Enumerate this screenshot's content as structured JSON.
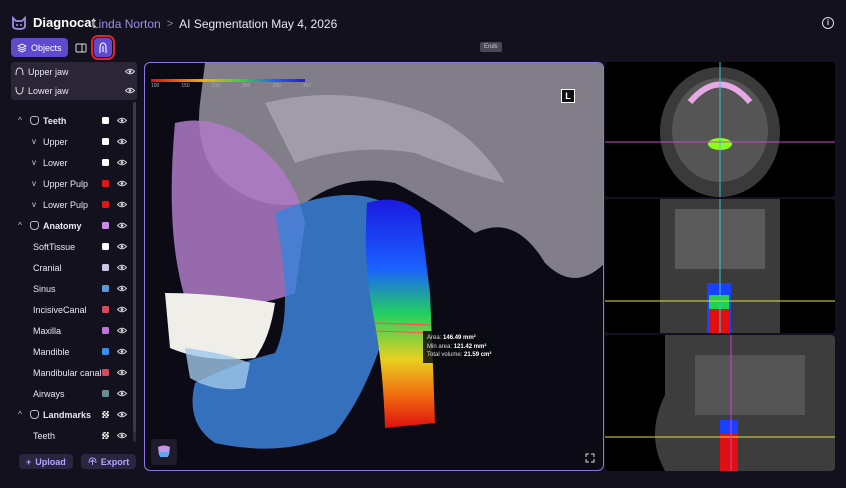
{
  "app": {
    "name": "Diagnocat"
  },
  "breadcrumb": {
    "user": "Linda Norton",
    "separator": ">",
    "page": "AI Segmentation May 4, 2026"
  },
  "toolbar": {
    "objects_label": "Objects",
    "tooltip": "Ends"
  },
  "jaws": [
    {
      "label": "Upper jaw",
      "icon": "upper-jaw-icon"
    },
    {
      "label": "Lower jaw",
      "icon": "lower-jaw-icon"
    }
  ],
  "tree": [
    {
      "label": "Teeth",
      "group": true,
      "color": "#ffffff",
      "icon": "tooth-icon"
    },
    {
      "label": "Upper",
      "child": true,
      "color": "#ffffff"
    },
    {
      "label": "Lower",
      "child": true,
      "color": "#ffffff"
    },
    {
      "label": "Upper Pulp",
      "child": true,
      "color": "#e0151a"
    },
    {
      "label": "Lower Pulp",
      "child": true,
      "color": "#e0151a"
    },
    {
      "label": "Anatomy",
      "group": true,
      "color": "#c98ae0",
      "icon": "skull-icon"
    },
    {
      "label": "SoftTissue",
      "color": "#ffffff"
    },
    {
      "label": "Cranial",
      "color": "#c9c5e6"
    },
    {
      "label": "Sinus",
      "color": "#5b98d6"
    },
    {
      "label": "IncisiveCanal",
      "color": "#d24a5c"
    },
    {
      "label": "Maxilla",
      "color": "#c173de"
    },
    {
      "label": "Mandible",
      "color": "#3d8bea"
    },
    {
      "label": "Mandibular canal",
      "color": "#d24a5c"
    },
    {
      "label": "Airways",
      "color": "#6a8c95"
    },
    {
      "label": "Landmarks",
      "group": true,
      "color": "checker",
      "icon": "landmark-icon"
    },
    {
      "label": "Teeth",
      "color": "checker"
    }
  ],
  "buttons": {
    "upload": "Upload",
    "export": "Export"
  },
  "viewport": {
    "scale_labels": [
      "100",
      "150",
      "200",
      "250",
      "300",
      "350"
    ],
    "orientation": "L",
    "measure": {
      "area_label": "Area:",
      "area_value": "146.49 mm²",
      "min_label": "Min area:",
      "min_value": "121.42 mm²",
      "vol_label": "Total volume:",
      "vol_value": "21.59 cm³"
    }
  },
  "colors": {
    "accent": "#5f49cf",
    "highlight": "#e02323",
    "border": "#8b77e6"
  }
}
